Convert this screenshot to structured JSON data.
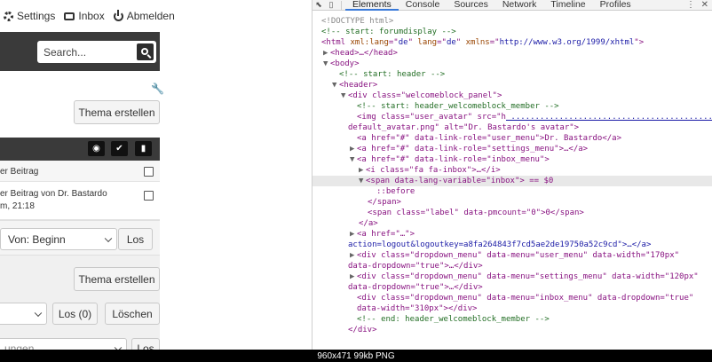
{
  "forum": {
    "nav": {
      "settings": "Settings",
      "inbox": "Inbox",
      "logout": "Abmelden"
    },
    "search_placeholder": "Search...",
    "new_thread_label": "Thema erstellen",
    "rows": [
      {
        "text": "er Beitrag"
      },
      {
        "text_a": "er Beitrag",
        "text_b": " von ",
        "author": "Dr. Bastardo",
        "time": "m, 21:18"
      }
    ],
    "from_select": "Von: Beginn",
    "los_label": "Los",
    "los_count_label": "Los (0)",
    "delete_label": "Löschen",
    "partial_select": "ungen"
  },
  "devtools": {
    "tabs": [
      "Elements",
      "Console",
      "Sources",
      "Network",
      "Timeline",
      "Profiles"
    ],
    "active_tab": "Elements",
    "lines": [
      "<!DOCTYPE html>",
      "<!-- start: forumdisplay -->",
      "html_open",
      "<head>…</head>",
      "<body>",
      "<!-- start: header -->",
      "<header>",
      "<div class=\"welcomeblock_panel\">",
      "<!-- start: header_welcomeblock_member -->",
      "img_line",
      "default_avatar.png\" alt=\"Dr. Bastardo's avatar\">",
      "<a href=\"#\" data-link-role=\"user_menu\">Dr. Bastardo</a>",
      "<a href=\"#\" data-link-role=\"settings_menu\">…</a>",
      "<a href=\"#\" data-link-role=\"inbox_menu\">",
      "<i class=\"fa fa-inbox\">…</i>",
      "<span data-lang-variable=\"inbox\"> == $0",
      "::before",
      "</span>",
      "<span class=\"label\" data-pmcount=\"0\">0</span>",
      "</a>",
      "<a href=\"…\">",
      "action=logout&logoutkey=a8fa264843f7cd5ae2de19750a52c9cd\">…</a>",
      "<div class=\"dropdown_menu\" data-menu=\"user_menu\" data-width=\"170px\"",
      "data-dropdown=\"true\">…</div>",
      "<div class=\"dropdown_menu\" data-menu=\"settings_menu\" data-width=\"120px\"",
      "data-dropdown=\"true\">…</div>",
      "<div class=\"dropdown_menu\" data-menu=\"inbox_menu\" data-dropdown=\"true\"",
      "data-width=\"310px\"></div>",
      "<!-- end: header_welcomeblock_member -->",
      "</div>"
    ],
    "img_prefix": "<img class=\"user_avatar\" src=\"h",
    "html_lang": "de",
    "html_xmlns": "http://www.w3.org/1999/xhtml",
    "selection_marker": "== $0"
  },
  "caption": "960x471  99kb  PNG"
}
